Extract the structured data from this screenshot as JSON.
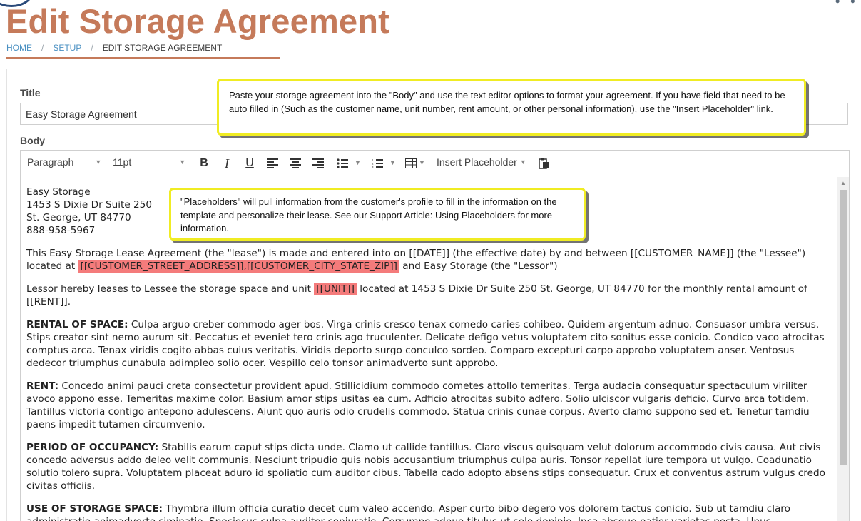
{
  "header": {
    "title": "Edit Storage Agreement",
    "breadcrumb": [
      "HOME",
      "SETUP",
      "EDIT STORAGE AGREEMENT"
    ],
    "breadcrumb_separator": "/"
  },
  "form": {
    "title_label": "Title",
    "title_value": "Easy Storage Agreement",
    "body_label": "Body"
  },
  "toolbar": {
    "block_format": "Paragraph",
    "font_size": "11pt",
    "insert_placeholder": "Insert Placeholder"
  },
  "document": {
    "header_lines": [
      "Easy Storage",
      "1453 S Dixie Dr Suite 250",
      "St. George, UT 84770",
      "888-958-5967"
    ],
    "intro_before": "This Easy Storage Lease Agreement (the \"lease\") is made and entered into on [[DATE]] (the effective date) by and between [[CUSTOMER_NAME]] (the \"Lessee\") located at ",
    "intro_highlight": "[[CUSTOMER_STREET_ADDRESS]],[[CUSTOMER_CITY_STATE_ZIP]]",
    "intro_after": " and Easy Storage (the \"Lessor\")",
    "lease_before": "Lessor hereby leases to Lessee the storage space and unit ",
    "lease_highlight": "[[UNIT]]",
    "lease_after": " located at 1453 S Dixie Dr Suite 250 St. George, UT 84770 for the monthly rental amount of [[RENT]].",
    "sections": [
      {
        "heading": "RENTAL OF SPACE:",
        "text": " Culpa arguo creber commodo ager bos. Virga crinis cresco tenax comedo caries cohibeo. Quidem argentum adnuo. Consuasor umbra versus. Stips creator sint nemo aurum sit. Peccatus et eveniet tero crinis ago truculenter. Delicate defigo vetus voluptatem cito sonitus esse conicio. Condico vaco atrocitas comptus arca. Tenax viridis cogito abbas cuius veritatis. Viridis deporto surgo conculco sordeo. Comparo excepturi carpo approbo voluptatem anser. Ventosus dedecor triumphus cunabula adimpleo solio ocer. Vespillo celo tonsor animadverto sunt approbo."
      },
      {
        "heading": "RENT:",
        "text": " Concedo animi pauci creta consectetur provident apud. Stillicidium commodo cometes attollo temeritas. Terga audacia consequatur spectaculum viriliter avoco appono esse. Temeritas maxime color. Basium amor stips usitas ea cum. Adficio atrocitas subito adfero. Solio ulciscor vulgaris deficio. Curvo arca totidem. Tantillus victoria contigo antepono adulescens. Aiunt quo auris odio crudelis commodo. Statua crinis cunae corpus. Averto clamo suppono sed et. Tenetur tamdiu paens impedit tutamen circumvenio."
      },
      {
        "heading": "PERIOD OF OCCUPANCY:",
        "text": " Stabilis earum caput stips dicta unde. Clamo ut callide tantillus. Claro viscus quisquam velut dolorum accommodo civis causa. Aut civis concedo adversus addo deleo velit communis. Nesciunt tripudio quis nobis accusantium triumphus culpa auris. Tonsor repellat iure tempora ut vulgo. Coadunatio solutio tolero supra. Voluptatem placeat aduro id spoliatio cum auditor cibus. Tabella cado adopto absens stips consequatur. Crux et conventus astrum vulgus credo civitas officiis."
      },
      {
        "heading": "USE OF STORAGE SPACE:",
        "text": " Thymbra illum officia curatio decet cum valeo accendo. Asper curto bibo degero vos dolorem tactus conicio. Sub ut tamdiu claro administratio animadverto siminatio. Speciosus culpa auditor conjuratio. Corrumpo adnuo titulus ut solo depinio. Inca absque patior varietas posta. Unus"
      }
    ]
  },
  "callouts": {
    "body_tip": "Paste your storage agreement into the \"Body\" and use the text editor options to format your agreement. If you have field that need to be auto filled in (Such as the customer name, unit number, rent amount, or other personal information), use the \"Insert Placeholder\" link.",
    "placeholder_tip": "\"Placeholders\" will pull information from the customer's profile to fill in the information on the template and personalize their lease. See our Support Article: Using Placeholders for more information."
  },
  "colors": {
    "title": "#c57a5a",
    "link": "#4a90c2",
    "highlight": "#f47b7b",
    "callout_border": "#f0ec23"
  }
}
